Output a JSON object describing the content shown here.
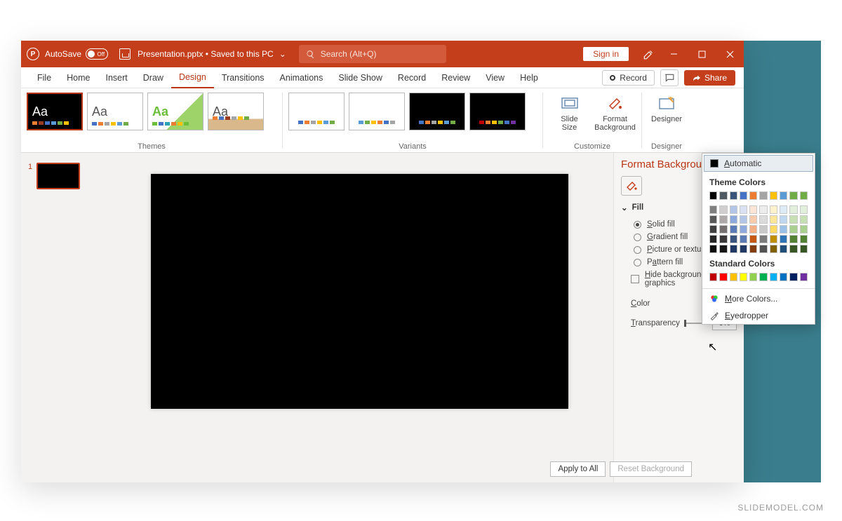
{
  "titlebar": {
    "autosave_label": "AutoSave",
    "autosave_state": "Off",
    "filename": "Presentation.pptx",
    "saved_text": "Saved to this PC",
    "search_placeholder": "Search (Alt+Q)",
    "signin": "Sign in"
  },
  "tabs": {
    "items": [
      "File",
      "Home",
      "Insert",
      "Draw",
      "Design",
      "Transitions",
      "Animations",
      "Slide Show",
      "Record",
      "Review",
      "View",
      "Help"
    ],
    "active": "Design",
    "record": "Record",
    "share": "Share"
  },
  "ribbon": {
    "themes_label": "Themes",
    "variants_label": "Variants",
    "customize_label": "Customize",
    "designer_label": "Designer",
    "slide_size": "Slide\nSize",
    "format_bg": "Format\nBackground",
    "designer_btn": "Designer"
  },
  "thumbs": {
    "n1": "1"
  },
  "pane": {
    "title": "Format Background",
    "fill": "Fill",
    "solid": "Solid fill",
    "gradient": "Gradient fill",
    "picture": "Picture or texture fill",
    "pattern": "Pattern fill",
    "hide": "Hide background graphics",
    "color": "Color",
    "transparency": "Transparency",
    "trans_val": "0%",
    "apply": "Apply to All",
    "reset": "Reset Background"
  },
  "picker": {
    "automatic": "Automatic",
    "theme": "Theme Colors",
    "standard": "Standard Colors",
    "more": "More Colors...",
    "eyedropper": "Eyedropper",
    "theme_row": [
      "#000000",
      "#4e5a64",
      "#39567a",
      "#4472c4",
      "#ed7d31",
      "#a5a5a5",
      "#ffc000",
      "#5b9bd5",
      "#70ad47",
      "#70ad47"
    ],
    "tints": [
      [
        "#7f7f7f",
        "#d0cece",
        "#b4c6e7",
        "#d9e1f2",
        "#fce4d6",
        "#ededed",
        "#fff2cc",
        "#ddebf7",
        "#e2efda",
        "#e2efda"
      ],
      [
        "#595959",
        "#aeaaaa",
        "#8ea9db",
        "#b4c6e7",
        "#f8cbad",
        "#dbdbdb",
        "#ffe699",
        "#bdd7ee",
        "#c6e0b4",
        "#c6e0b4"
      ],
      [
        "#404040",
        "#757171",
        "#5b7bb4",
        "#8ea9db",
        "#f4b084",
        "#c9c9c9",
        "#ffd966",
        "#9bc2e6",
        "#a9d08e",
        "#a9d08e"
      ],
      [
        "#262626",
        "#3a3838",
        "#3a567e",
        "#5b7bb4",
        "#c65911",
        "#7b7b7b",
        "#bf8f00",
        "#2f75b5",
        "#548235",
        "#548235"
      ],
      [
        "#0d0d0d",
        "#161616",
        "#1f3864",
        "#1f3864",
        "#833c0c",
        "#525252",
        "#806000",
        "#1f4e78",
        "#375623",
        "#375623"
      ]
    ],
    "standard_row": [
      "#c00000",
      "#ff0000",
      "#ffc000",
      "#ffff00",
      "#92d050",
      "#00b050",
      "#00b0f0",
      "#0070c0",
      "#002060",
      "#7030a0"
    ]
  },
  "watermark": "SLIDEMODEL.COM"
}
